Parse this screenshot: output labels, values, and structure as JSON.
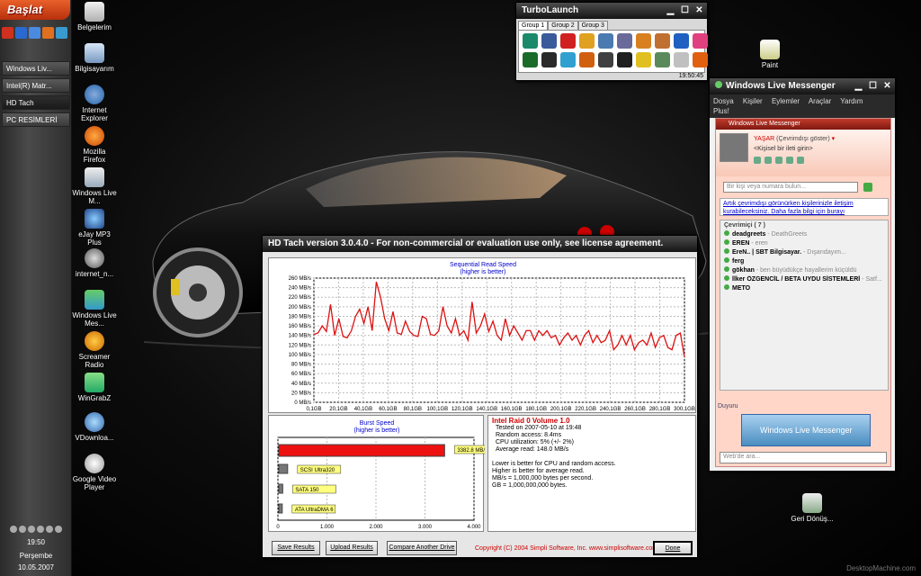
{
  "taskbar": {
    "start": "Başlat",
    "tasks": [
      "Windows Liv...",
      "Intel(R) Matr...",
      "HD Tach",
      "PC RESİMLERİ"
    ],
    "clock": "19:50",
    "day": "Perşembe",
    "date": "10.05.2007"
  },
  "desktop_icons": [
    {
      "label": "Belgelerim",
      "icon": "folder-icon"
    },
    {
      "label": "Bilgisayarım",
      "icon": "computer-icon"
    },
    {
      "label": "Internet Explorer",
      "icon": "ie-icon"
    },
    {
      "label": "Mozilla Firefox",
      "icon": "firefox-icon"
    },
    {
      "label": "Windows Live M...",
      "icon": "msn-icon"
    },
    {
      "label": "eJay MP3 Plus",
      "icon": "music-icon"
    },
    {
      "label": "internet_n...",
      "icon": "network-icon"
    },
    {
      "label": "Windows Live Mes...",
      "icon": "msn-people-icon"
    },
    {
      "label": "Screamer Radio",
      "icon": "radio-icon"
    },
    {
      "label": "WinGrabZ",
      "icon": "grab-icon"
    },
    {
      "label": "VDownloa...",
      "icon": "download-icon"
    },
    {
      "label": "Google Video Player",
      "icon": "video-icon"
    },
    {
      "label": "Paint",
      "icon": "paint-icon"
    },
    {
      "label": "Geri Dönüş...",
      "icon": "recycle-bin-icon"
    }
  ],
  "watermark": "DesktopMachine.com",
  "turbolaunch": {
    "title": "TurboLaunch",
    "tabs": [
      "Group 1",
      "Group 2",
      "Group 3"
    ],
    "clock": "19:50:45",
    "icon_colors": [
      "#1a8a6a",
      "#3a5a9a",
      "#d02020",
      "#e0a020",
      "#4a7ab0",
      "#6a6a9a",
      "#d88020",
      "#c07030",
      "#2060c0",
      "#e04080",
      "#1a6a2a",
      "#2a2a2a",
      "#30a0d0",
      "#d06010",
      "#404040",
      "#202020",
      "#e0c020",
      "#5a8a5a",
      "#c0c0c0",
      "#e06010"
    ]
  },
  "messenger": {
    "title": "Windows Live Messenger",
    "menu": [
      "Dosya",
      "Kişiler",
      "Eylemler",
      "Araçlar",
      "Yardım",
      "Plus!"
    ],
    "inner_title": "Windows Live Messenger",
    "user": "YAŞAR",
    "status": "(Çevrimdışı göster)",
    "personal": "<Kişisel bir ileti girin>",
    "search_placeholder": "Bir kişi veya numara bulun...",
    "notice": "Artık çevrimdışı görünürken kişilerinizle iletişim kurabileceksiniz. Daha fazla bilgi için burayı",
    "group": "Çevrimiçi ( 7 )",
    "contacts": [
      {
        "name": "deadgreets",
        "msg": "- DeathGreets"
      },
      {
        "name": "EREN",
        "msg": "- eren"
      },
      {
        "name": "ErеN.. | SBT Bilgisayar.",
        "msg": "- Dışarıdayım..."
      },
      {
        "name": "ferg",
        "msg": ""
      },
      {
        "name": "gökhan",
        "msg": "- ben büyüdükçe hayallerim küçüldü"
      },
      {
        "name": "İlker ÖZGENCİL / BETA UYDU SİSTEMLERİ",
        "msg": "- Satf..."
      },
      {
        "name": "METO",
        "msg": ""
      }
    ],
    "duyuru": "Duyuru",
    "banner": "Windows Live Messenger",
    "web_search": "Web'de ara..."
  },
  "hdtach": {
    "title": "HD Tach version 3.0.4.0  - For non-commercial or evaluation use only, see license agreement.",
    "info_title": "Intel Raid 0 Volume 1.0",
    "info_lines": [
      "Tested on 2007-05-10 at 19:48",
      "Random access: 8.4ms",
      "CPU utilization: 5% (+/- 2%)",
      "Average read: 148.0 MB/s"
    ],
    "notes": [
      "Lower is better for CPU and random access.",
      "Higher is better for average read.",
      "MB/s = 1,000,000 bytes per second.",
      "GB = 1,000,000,000 bytes."
    ],
    "buttons": [
      "Save Results",
      "Upload Results",
      "Compare Another Drive",
      "Done"
    ],
    "copyright": "Copyright (C) 2004 Simpli Software, Inc. www.simplisoftware.com"
  },
  "chart_data": [
    {
      "type": "line",
      "title": "Sequential Read Speed",
      "subtitle": "(higher is better)",
      "ylim": [
        0,
        260
      ],
      "y_ticks": [
        "0 MB/s",
        "20 MB/s",
        "40 MB/s",
        "60 MB/s",
        "80 MB/s",
        "100 MB/s",
        "120 MB/s",
        "140 MB/s",
        "160 MB/s",
        "180 MB/s",
        "200 MB/s",
        "220 MB/s",
        "240 MB/s",
        "260 MB/s"
      ],
      "x_ticks": [
        "0,1GB",
        "20,1GB",
        "40,1GB",
        "60,1GB",
        "80,1GB",
        "100,1GB",
        "120,1GB",
        "140,1GB",
        "160,1GB",
        "180,1GB",
        "200,1GB",
        "220,1GB",
        "240,1GB",
        "260,1GB",
        "280,1GB",
        "300,1GB"
      ],
      "xlim": [
        0,
        300
      ],
      "grid": true,
      "color": "#dd1111",
      "series": [
        {
          "values": [
            142,
            145,
            160,
            148,
            205,
            140,
            175,
            138,
            135,
            150,
            180,
            195,
            165,
            200,
            150,
            252,
            220,
            175,
            150,
            190,
            145,
            142,
            170,
            148,
            140,
            138,
            180,
            175,
            142,
            140,
            150,
            200,
            160,
            145,
            175,
            140,
            150,
            130,
            210,
            145,
            160,
            185,
            148,
            170,
            140,
            130,
            175,
            140,
            160,
            145,
            130,
            150,
            150,
            130,
            150,
            140,
            150,
            135,
            140,
            120,
            135,
            145,
            130,
            140,
            120,
            140,
            150,
            125,
            140,
            125,
            130,
            150,
            110,
            120,
            140,
            120,
            140,
            110,
            125,
            130,
            120,
            145,
            115,
            135,
            140,
            115,
            110,
            140,
            145,
            95
          ]
        }
      ]
    },
    {
      "type": "bar",
      "title": "Burst Speed",
      "subtitle": "(higher is better)",
      "xlim": [
        0,
        4000
      ],
      "x_ticks": [
        "0",
        "1.000",
        "2.000",
        "3.000",
        "4.000"
      ],
      "categories": [
        "Intel Raid 0",
        "SCSI Ultra320",
        "SATA 150",
        "ATA UltraDMA 6"
      ],
      "values": [
        3382.8,
        180,
        80,
        70
      ],
      "value_labels": [
        "3382.8 MB/s",
        "SCSI Ultra320",
        "SATA 150",
        "ATA UltraDMA 6"
      ]
    }
  ]
}
